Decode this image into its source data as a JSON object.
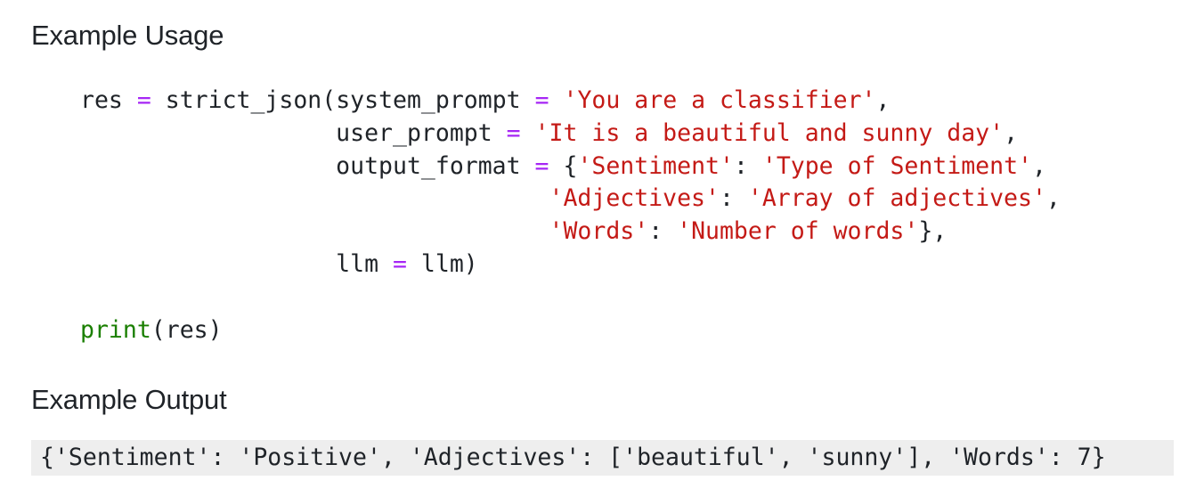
{
  "usage_heading": "Example Usage",
  "output_heading": "Example Output",
  "code": {
    "lines": [
      [
        {
          "t": "res ",
          "c": "plain"
        },
        {
          "t": "=",
          "c": "op"
        },
        {
          "t": " strict_json(system_prompt ",
          "c": "plain"
        },
        {
          "t": "=",
          "c": "op"
        },
        {
          "t": " ",
          "c": "plain"
        },
        {
          "t": "'You are a classifier'",
          "c": "str"
        },
        {
          "t": ",",
          "c": "plain"
        }
      ],
      [
        {
          "t": "                  user_prompt ",
          "c": "plain"
        },
        {
          "t": "=",
          "c": "op"
        },
        {
          "t": " ",
          "c": "plain"
        },
        {
          "t": "'It is a beautiful and sunny day'",
          "c": "str"
        },
        {
          "t": ",",
          "c": "plain"
        }
      ],
      [
        {
          "t": "                  output_format ",
          "c": "plain"
        },
        {
          "t": "=",
          "c": "op"
        },
        {
          "t": " {",
          "c": "plain"
        },
        {
          "t": "'Sentiment'",
          "c": "str"
        },
        {
          "t": ": ",
          "c": "plain"
        },
        {
          "t": "'Type of Sentiment'",
          "c": "str"
        },
        {
          "t": ",",
          "c": "plain"
        }
      ],
      [
        {
          "t": "                                 ",
          "c": "plain"
        },
        {
          "t": "'Adjectives'",
          "c": "str"
        },
        {
          "t": ": ",
          "c": "plain"
        },
        {
          "t": "'Array of adjectives'",
          "c": "str"
        },
        {
          "t": ",",
          "c": "plain"
        }
      ],
      [
        {
          "t": "                                 ",
          "c": "plain"
        },
        {
          "t": "'Words'",
          "c": "str"
        },
        {
          "t": ": ",
          "c": "plain"
        },
        {
          "t": "'Number of words'",
          "c": "str"
        },
        {
          "t": "},",
          "c": "plain"
        }
      ],
      [
        {
          "t": "                  llm ",
          "c": "plain"
        },
        {
          "t": "=",
          "c": "op"
        },
        {
          "t": " llm)",
          "c": "plain"
        }
      ],
      [],
      [
        {
          "t": "print",
          "c": "kw"
        },
        {
          "t": "(res)",
          "c": "plain"
        }
      ]
    ]
  },
  "output_text": "{'Sentiment': 'Positive', 'Adjectives': ['beautiful', 'sunny'], 'Words': 7}",
  "colors": {
    "operator": "#a626f5",
    "string": "#c41a16",
    "builtin": "#1a7f00",
    "text": "#1f2328",
    "output_background": "#eeeeee"
  }
}
